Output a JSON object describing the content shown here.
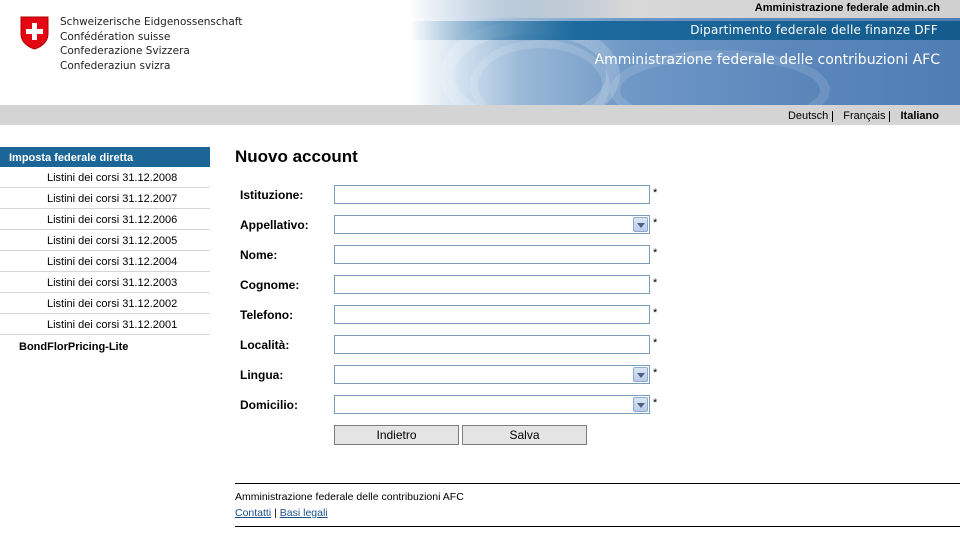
{
  "header": {
    "confederation_lines": [
      "Schweizerische Eidgenossenschaft",
      "Confédération suisse",
      "Confederazione Svizzera",
      "Confederaziun svizra"
    ],
    "admin_link": "Amministrazione federale admin.ch",
    "department": "Dipartimento federale delle finanze DFF",
    "office": "Amministrazione federale delle contribuzioni AFC"
  },
  "languages": [
    {
      "label": "Deutsch",
      "active": false
    },
    {
      "label": "Français",
      "active": false
    },
    {
      "label": "Italiano",
      "active": true
    }
  ],
  "sidebar": {
    "heading": "Imposta federale diretta",
    "items": [
      "Listini dei corsi 31.12.2008",
      "Listini dei corsi 31.12.2007",
      "Listini dei corsi 31.12.2006",
      "Listini dei corsi 31.12.2005",
      "Listini dei corsi 31.12.2004",
      "Listini dei corsi 31.12.2003",
      "Listini dei corsi 31.12.2002",
      "Listini dei corsi 31.12.2001"
    ],
    "extra": "BondFlorPricing-Lite"
  },
  "form": {
    "title": "Nuovo account",
    "fields": [
      {
        "label": "Istituzione:",
        "type": "text",
        "value": "",
        "required_mark": "*"
      },
      {
        "label": "Appellativo:",
        "type": "select",
        "value": "",
        "required_mark": "*"
      },
      {
        "label": "Nome:",
        "type": "text",
        "value": "",
        "required_mark": "*"
      },
      {
        "label": "Cognome:",
        "type": "text",
        "value": "",
        "required_mark": "*"
      },
      {
        "label": "Telefono:",
        "type": "text",
        "value": "",
        "required_mark": "*"
      },
      {
        "label": "Località:",
        "type": "text",
        "value": "",
        "required_mark": "*"
      },
      {
        "label": "Lingua:",
        "type": "select",
        "value": "",
        "required_mark": "*"
      },
      {
        "label": "Domicilio:",
        "type": "select",
        "value": "",
        "required_mark": "*"
      }
    ],
    "back_label": "Indietro",
    "save_label": "Salva"
  },
  "footer": {
    "office": "Amministrazione federale delle contribuzioni AFC",
    "contacts": "Contatti",
    "separator": "|",
    "legal": "Basi legali"
  },
  "colors": {
    "sidebar_heading": "#1c6597",
    "department_bar": "#145b8c",
    "crest_red": "#e30613"
  }
}
